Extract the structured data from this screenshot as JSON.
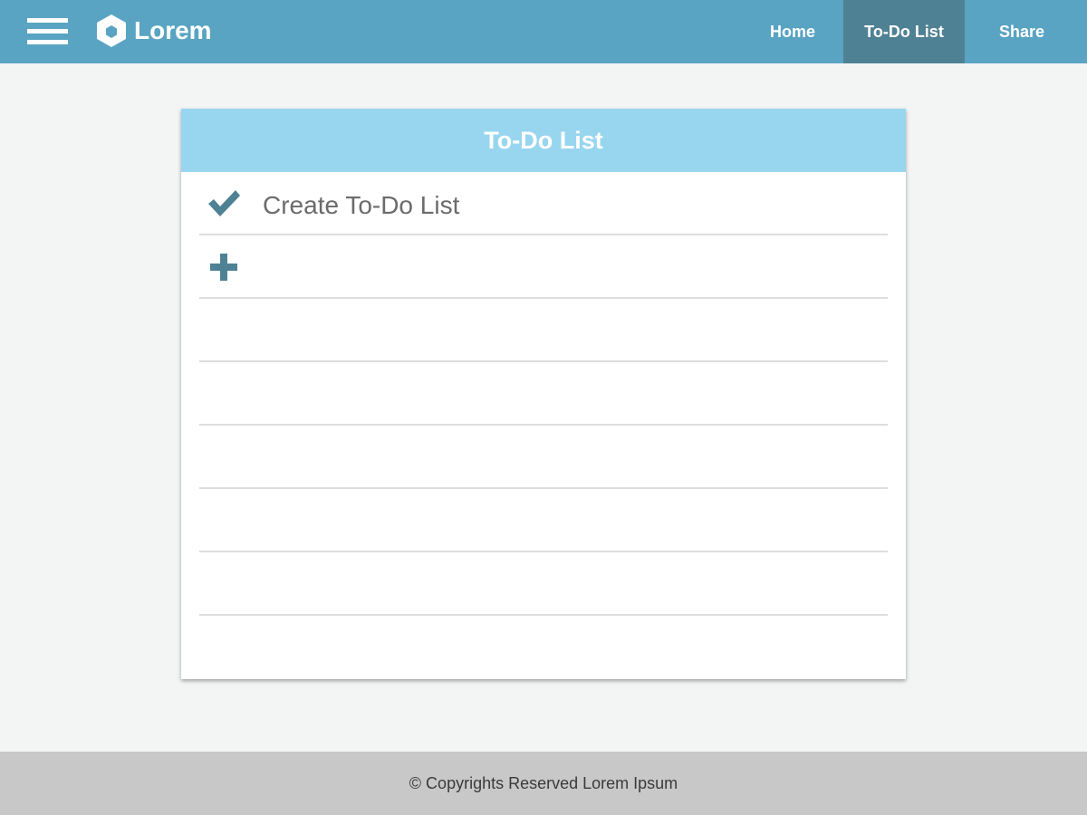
{
  "header": {
    "brand": "Lorem",
    "nav": [
      {
        "label": "Home",
        "active": false
      },
      {
        "label": "To-Do List",
        "active": true
      },
      {
        "label": "Share",
        "active": false
      }
    ],
    "icons": {
      "menu": "hamburger-icon",
      "logo": "hexagon-logo-icon"
    }
  },
  "todo": {
    "title": "To-Do List",
    "items": [
      {
        "text": "Create To-Do List",
        "icon": "checkmark-icon",
        "done": true
      }
    ],
    "add_icon": "plus-icon",
    "empty_rows": 6
  },
  "footer": {
    "text": "© Copyrights Reserved Lorem Ipsum"
  },
  "colors": {
    "navbar": "#59a4c2",
    "nav_active": "#4f8194",
    "card_header": "#98d6ef",
    "icon": "#4f8194",
    "footer": "#c8c8c8"
  }
}
